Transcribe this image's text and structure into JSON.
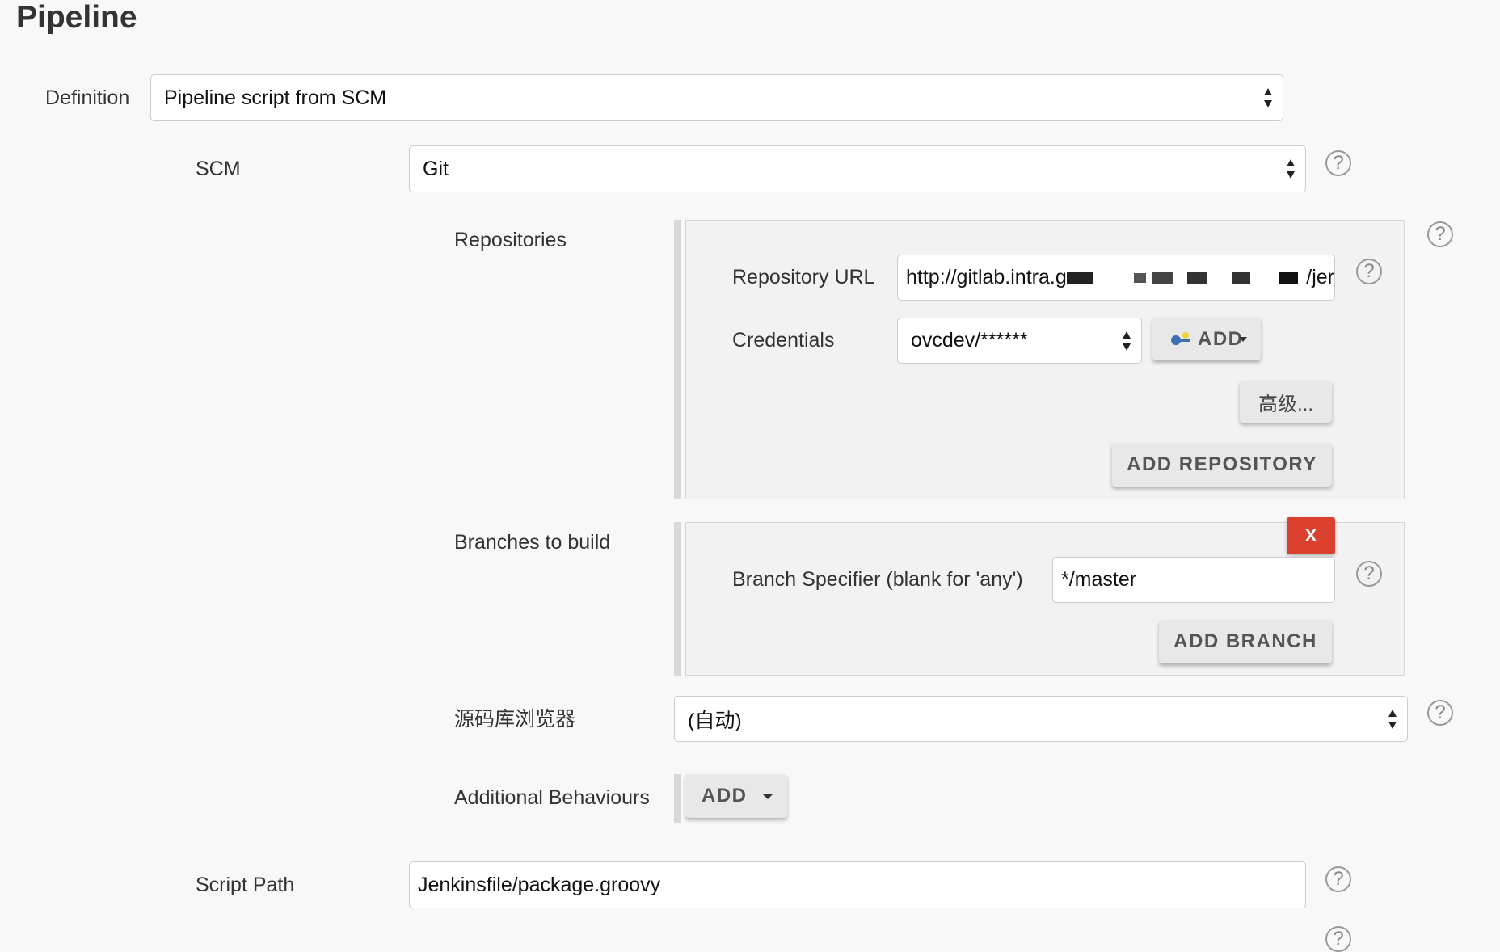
{
  "section": {
    "title": "Pipeline"
  },
  "definition": {
    "label": "Definition",
    "value": "Pipeline script from SCM"
  },
  "scm": {
    "label": "SCM",
    "value": "Git"
  },
  "repositories": {
    "label": "Repositories",
    "url_label": "Repository URL",
    "url_value_start": "http://gitlab.intra.g",
    "url_value_end": "/jer",
    "credentials_label": "Credentials",
    "credentials_value": "ovcdev/******",
    "add_credentials_label": "ADD",
    "advanced_label": "高级...",
    "add_repository_label": "ADD REPOSITORY"
  },
  "branches": {
    "label": "Branches to build",
    "specifier_label": "Branch Specifier (blank for 'any')",
    "specifier_value": "*/master",
    "delete_label": "X",
    "add_branch_label": "ADD BRANCH"
  },
  "browser": {
    "label": "源码库浏览器",
    "value": "(自动)"
  },
  "behaviours": {
    "label": "Additional Behaviours",
    "add_label": "ADD"
  },
  "script_path": {
    "label": "Script Path",
    "value": "Jenkinsfile/package.groovy"
  },
  "help_glyph": "?",
  "colors": {
    "background": "#f8f8f8",
    "panel": "#f2f2f2",
    "delete_button": "#d9412e"
  },
  "icons": {
    "select_arrows": "up-down-arrows-icon",
    "help": "question-circle-icon",
    "credentials_key": "key-icon",
    "dropdown_caret": "caret-down-icon"
  }
}
